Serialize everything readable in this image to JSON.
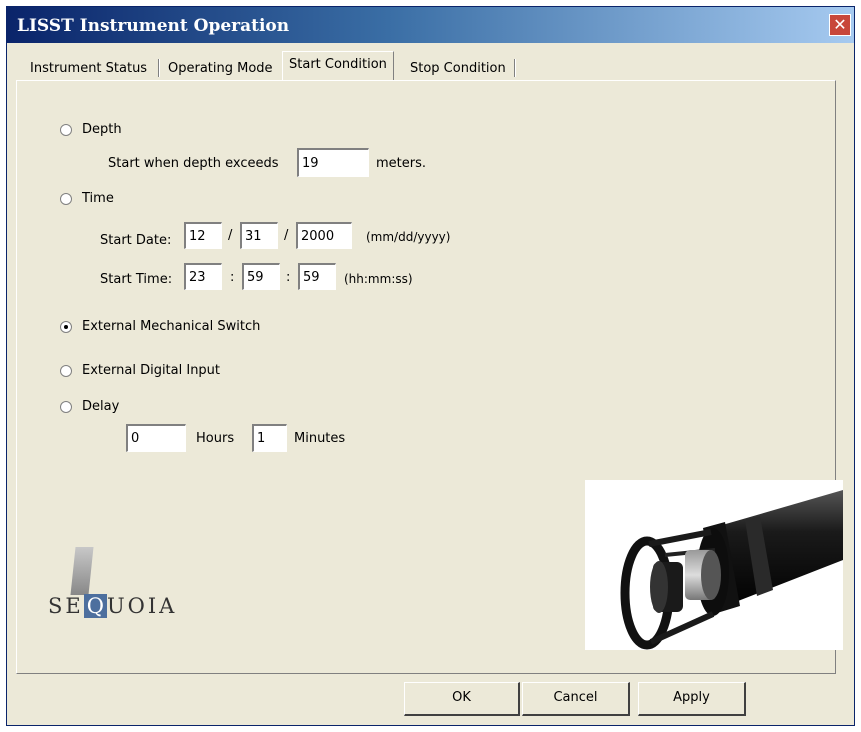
{
  "window": {
    "title": "LISST Instrument Operation",
    "close_glyph": "✕"
  },
  "tabs": [
    {
      "label": "Instrument Status"
    },
    {
      "label": "Operating Mode"
    },
    {
      "label": "Start Condition"
    },
    {
      "label": "Stop Condition"
    }
  ],
  "active_tab": "Start Condition",
  "depth": {
    "label": "Depth",
    "selected": false,
    "prefix": "Start when depth exceeds",
    "value": "19",
    "unit": "meters."
  },
  "time": {
    "label": "Time",
    "selected": false,
    "date_label": "Start Date:",
    "month": "12",
    "day": "31",
    "year": "2000",
    "date_sep": "/",
    "date_format": "(mm/dd/yyyy)",
    "time_label": "Start Time:",
    "hour": "23",
    "minute": "59",
    "second": "59",
    "time_sep": ":",
    "time_format": "(hh:mm:ss)"
  },
  "external_mechanical": {
    "label": "External Mechanical Switch",
    "selected": true
  },
  "external_digital": {
    "label": "External Digital Input",
    "selected": false
  },
  "delay": {
    "label": "Delay",
    "selected": false,
    "hours_value": "0",
    "hours_label": "Hours",
    "minutes_value": "1",
    "minutes_label": "Minutes"
  },
  "logo": {
    "text_left": "SE",
    "text_q": "Q",
    "text_right": "UOIA"
  },
  "buttons": {
    "ok": "OK",
    "cancel": "Cancel",
    "apply": "Apply"
  },
  "icons": {
    "photo": "lisst-instrument-photo",
    "logo": "sequoia-logo"
  }
}
